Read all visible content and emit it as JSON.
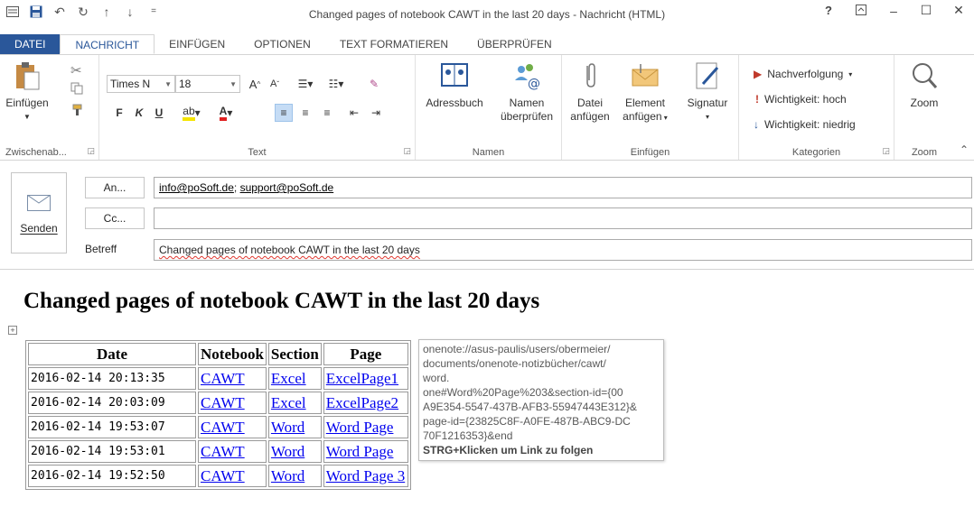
{
  "window": {
    "title": "Changed pages of notebook CAWT in the last 20 days - Nachricht (HTML)",
    "help": "?"
  },
  "tabs": [
    {
      "label": "DATEI"
    },
    {
      "label": "NACHRICHT"
    },
    {
      "label": "EINFÜGEN"
    },
    {
      "label": "OPTIONEN"
    },
    {
      "label": "TEXT FORMATIEREN"
    },
    {
      "label": "ÜBERPRÜFEN"
    }
  ],
  "ribbon": {
    "clipboard": {
      "paste": "Einfügen",
      "label": "Zwischenab..."
    },
    "text": {
      "font": "Times N",
      "size": "18",
      "bold": "F",
      "italic": "K",
      "underline": "U",
      "label": "Text"
    },
    "names": {
      "addressbook": "Adressbuch",
      "check1": "Namen",
      "check2": "überprüfen",
      "label": "Namen"
    },
    "insert": {
      "file1": "Datei",
      "file2": "anfügen",
      "item1": "Element",
      "item2": "anfügen",
      "signature": "Signatur",
      "label": "Einfügen"
    },
    "tags": {
      "followup": "Nachverfolgung",
      "high": "Wichtigkeit: hoch",
      "low": "Wichtigkeit: niedrig",
      "label": "Kategorien"
    },
    "zoom": {
      "button": "Zoom",
      "label": "Zoom"
    }
  },
  "header": {
    "send": "Senden",
    "to_button": "An...",
    "cc_button": "Cc...",
    "subject_label": "Betreff",
    "to_addr1": "info@poSoft.de",
    "to_sep": "; ",
    "to_addr2": "support@poSoft.de",
    "cc_value": "",
    "subject_value": "Changed pages of notebook CAWT in the last 20 days"
  },
  "body": {
    "heading": "Changed pages of notebook CAWT in the last 20 days",
    "table": {
      "headers": [
        "Date",
        "Notebook",
        "Section",
        "Page"
      ],
      "rows": [
        [
          "2016-02-14 20:13:35",
          "CAWT",
          "Excel",
          "ExcelPage1"
        ],
        [
          "2016-02-14 20:03:09",
          "CAWT",
          "Excel",
          "ExcelPage2"
        ],
        [
          "2016-02-14 19:53:07",
          "CAWT",
          "Word",
          "Word Page"
        ],
        [
          "2016-02-14 19:53:01",
          "CAWT",
          "Word",
          "Word Page"
        ],
        [
          "2016-02-14 19:52:50",
          "CAWT",
          "Word",
          "Word Page 3"
        ]
      ]
    },
    "tooltip": {
      "lines": [
        "onenote://asus-paulis/users/obermeier/",
        "documents/onenote-notizbücher/cawt/",
        "word.",
        "one#Word%20Page%203&section-id={00",
        "A9E354-5547-437B-AFB3-55947443E312}&",
        "page-id={23825C8F-A0FE-487B-ABC9-DC",
        "70F1216353}&end"
      ],
      "hint": "STRG+Klicken um Link zu folgen"
    }
  },
  "colors": {
    "accent": "#2a579a",
    "link": "#0000ee",
    "flag": "#c0392b"
  }
}
